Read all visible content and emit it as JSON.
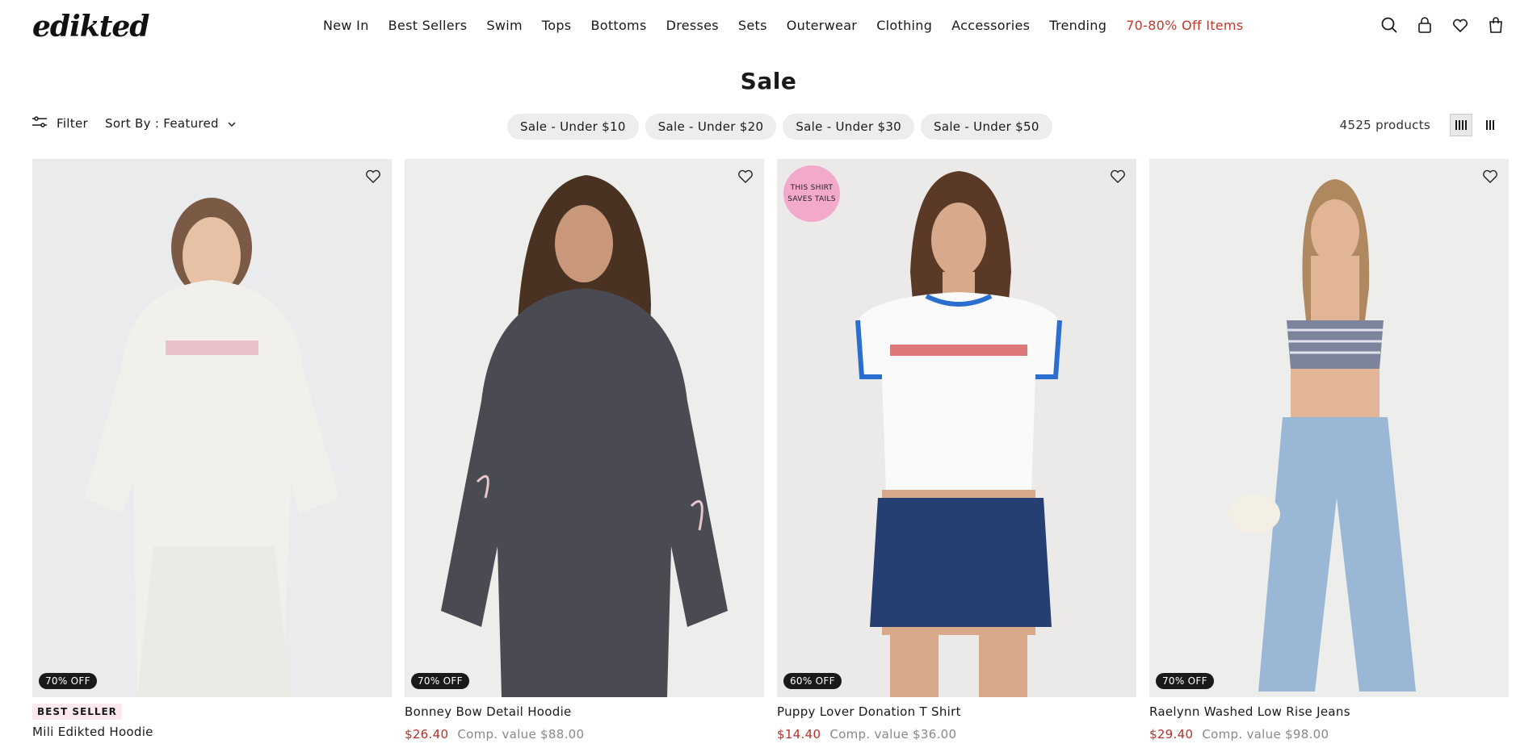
{
  "header": {
    "logo": "edikted",
    "nav": [
      {
        "label": "New In"
      },
      {
        "label": "Best Sellers"
      },
      {
        "label": "Swim"
      },
      {
        "label": "Tops"
      },
      {
        "label": "Bottoms"
      },
      {
        "label": "Dresses"
      },
      {
        "label": "Sets"
      },
      {
        "label": "Outerwear"
      },
      {
        "label": "Clothing"
      },
      {
        "label": "Accessories"
      },
      {
        "label": "Trending"
      },
      {
        "label": "70-80% Off Items"
      }
    ],
    "icons": [
      "search-icon",
      "account-icon",
      "heart-icon",
      "bag-icon"
    ]
  },
  "page": {
    "title": "Sale"
  },
  "toolbar": {
    "filter_label": "Filter",
    "sort_label": "Sort By : Featured",
    "pills": [
      "Sale - Under $10",
      "Sale - Under $20",
      "Sale - Under $30",
      "Sale - Under $50"
    ],
    "count": "4525 products"
  },
  "products": [
    {
      "name": "Mili Edikted Hoodie",
      "discount": "70% OFF",
      "badge": "BEST SELLER",
      "sale_price": "",
      "comp_value": ""
    },
    {
      "name": "Bonney Bow Detail Hoodie",
      "discount": "70% OFF",
      "sale_price": "$26.40",
      "comp_value": "Comp. value $88.00"
    },
    {
      "name": "Puppy Lover Donation T Shirt",
      "discount": "60% OFF",
      "donation_badge": "THIS SHIRT SAVES TAILS",
      "sale_price": "$14.40",
      "comp_value": "Comp. value $36.00"
    },
    {
      "name": "Raelynn Washed Low Rise Jeans",
      "discount": "70% OFF",
      "sale_price": "$29.40",
      "comp_value": "Comp. value $98.00"
    }
  ],
  "colors": {
    "sale_accent": "#b5322e",
    "pill_bg": "#ededed",
    "discount_bg": "#1a1a1a",
    "donation_bg": "#f3a9cc"
  }
}
